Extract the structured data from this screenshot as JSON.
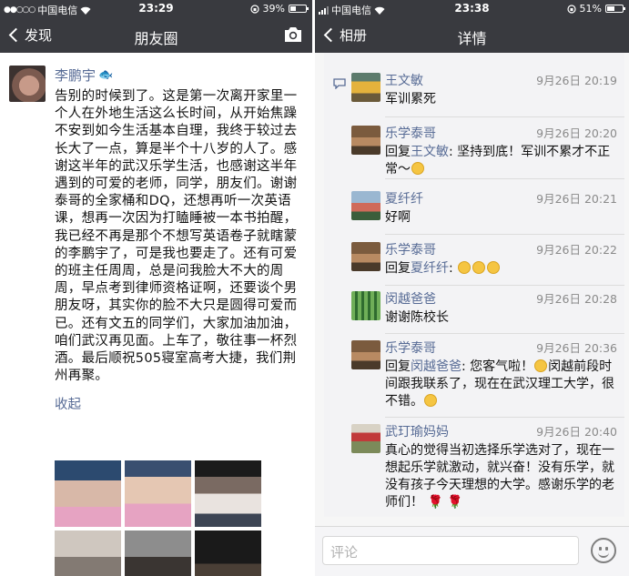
{
  "left": {
    "status": {
      "dots": "●●○○○",
      "carrier": "中国电信",
      "time": "23:29",
      "battery": "39%",
      "battery_level": 0.39
    },
    "nav": {
      "back": "发现",
      "title": "朋友圈",
      "camera_icon": "camera-icon"
    },
    "post": {
      "author": "李鹏宇",
      "author_emoji": "🐟",
      "content": "告别的时候到了。这是第一次离开家里一个人在外地生活这么长时间，从开始焦躁不安到如今生活基本自理，我终于较过去长大了一点，算是半个十八岁的人了。感谢这半年的武汉乐学生活，也感谢这半年遇到的可爱的老师，同学，朋友们。谢谢泰哥的全家桶和DQ，还想再听一次英语课，想再一次因为打瞌睡被一本书拍醒，我已经不再是那个不想写英语卷子就瞎蒙的李鹏宇了，可是我也要走了。还有可爱的班主任周周，总是问我脸大不大的周周，早点考到律师资格证啊，还要谈个男朋友呀，其实你的脸不大只是圆得可爱而已。还有文五的同学们，大家加油加油，咱们武汉再见面。上车了，敬往事一杯烈酒。最后顺祝505寝室高考大捷，我们荆州再聚。",
      "collapse": "收起"
    }
  },
  "right": {
    "status": {
      "carrier": "中国电信",
      "time": "23:38",
      "battery": "51%",
      "battery_level": 0.51
    },
    "nav": {
      "back": "相册",
      "title": "详情"
    },
    "comments": [
      {
        "name": "王文敏",
        "time": "9月26日 20:19",
        "prefix": "",
        "reply_to": "",
        "text": "军训累死",
        "suffix": ""
      },
      {
        "name": "乐学泰哥",
        "time": "9月26日 20:20",
        "prefix": "回复",
        "reply_to": "王文敏",
        "text": ": 坚持到底！军训不累才不正常～",
        "suffix": ""
      },
      {
        "name": "夏纤纤",
        "time": "9月26日 20:21",
        "prefix": "",
        "reply_to": "",
        "text": "好啊",
        "suffix": ""
      },
      {
        "name": "乐学泰哥",
        "time": "9月26日 20:22",
        "prefix": "回复",
        "reply_to": "夏纤纤",
        "text": ": ",
        "suffix": ""
      },
      {
        "name": "闵越爸爸",
        "time": "9月26日 20:28",
        "prefix": "",
        "reply_to": "",
        "text": "谢谢陈校长",
        "suffix": ""
      },
      {
        "name": "乐学泰哥",
        "time": "9月26日 20:36",
        "prefix": "回复",
        "reply_to": "闵越爸爸",
        "text": ": 您客气啦！",
        "suffix": "闵越前段时间跟我联系了，现在在武汉理工大学，很不错。"
      },
      {
        "name": "武玎瑜妈妈",
        "time": "9月26日 20:40",
        "prefix": "",
        "reply_to": "",
        "text": "真心的觉得当初选择乐学选对了，现在一想起乐学就激动，就兴奋！没有乐学，就没有孩子今天理想的大学。感谢乐学的老师们！",
        "suffix": ""
      }
    ],
    "input_placeholder": "评论"
  }
}
